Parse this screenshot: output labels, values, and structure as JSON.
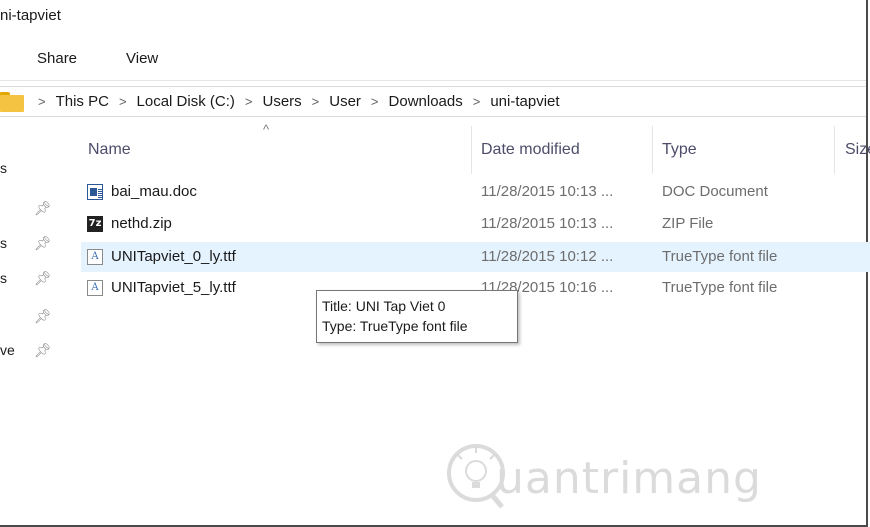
{
  "window": {
    "title": "ni-tapviet"
  },
  "ribbon": {
    "tabs": [
      "Share",
      "View"
    ]
  },
  "address": {
    "separator": ">",
    "crumbs": [
      "This PC",
      "Local Disk (C:)",
      "Users",
      "User",
      "Downloads",
      "uni-tapviet"
    ]
  },
  "nav": {
    "fragments": [
      "s",
      "s",
      "s",
      "ve"
    ]
  },
  "columns": {
    "name": "Name",
    "date": "Date modified",
    "type": "Type",
    "size": "Size",
    "sort_indicator": "^"
  },
  "files": [
    {
      "name": "bai_mau.doc",
      "date": "11/28/2015 10:13 ...",
      "type": "DOC Document",
      "icon": "word-doc-icon"
    },
    {
      "name": "nethd.zip",
      "date": "11/28/2015 10:13 ...",
      "type": "ZIP File",
      "icon": "7z-archive-icon",
      "icon_glyph": "7z"
    },
    {
      "name": "UNITapviet_0_ly.ttf",
      "date": "11/28/2015 10:12 ...",
      "type": "TrueType font file",
      "icon": "truetype-font-icon",
      "icon_glyph": "A"
    },
    {
      "name": "UNITapviet_5_ly.ttf",
      "date": "11/28/2015 10:16 ...",
      "type": "TrueType font file",
      "icon": "truetype-font-icon",
      "icon_glyph": "A"
    }
  ],
  "tooltip": {
    "title_line": "Title: UNI Tap Viet 0",
    "type_line": "Type: TrueType font file"
  },
  "watermark": {
    "text": "uantrimang"
  },
  "colors": {
    "hover_row": "#e5f3ff",
    "header_text": "#4d4d6b",
    "folder": "#f5c342"
  }
}
